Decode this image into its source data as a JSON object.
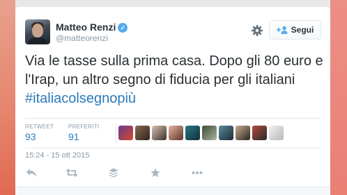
{
  "tweet": {
    "author": {
      "name": "Matteo Renzi",
      "handle": "@matteorenzi",
      "verified_glyph": "✓"
    },
    "follow_label": "Segui",
    "text_plain": "Via le tasse sulla prima casa. Dopo gli 80 euro e l'Irap, un altro segno di fiducia per gli italiani ",
    "hashtag": "#italiacolsegnopiù",
    "stats": {
      "retweet_label": "RETWEET",
      "retweet_count": "93",
      "likes_label": "PREFERITI",
      "likes_count": "91"
    },
    "timestamp": "15:24 - 15 ott 2015"
  },
  "icons": {
    "settings": "gear-icon",
    "follow": "add-user-icon",
    "reply": "reply-icon",
    "retweet": "retweet-icon",
    "buffer": "buffer-icon",
    "favorite": "star-icon",
    "more": "more-icon"
  },
  "colors": {
    "link": "#2b7bb9",
    "verified": "#55acee",
    "muted": "#8899a6",
    "text": "#292f33"
  }
}
